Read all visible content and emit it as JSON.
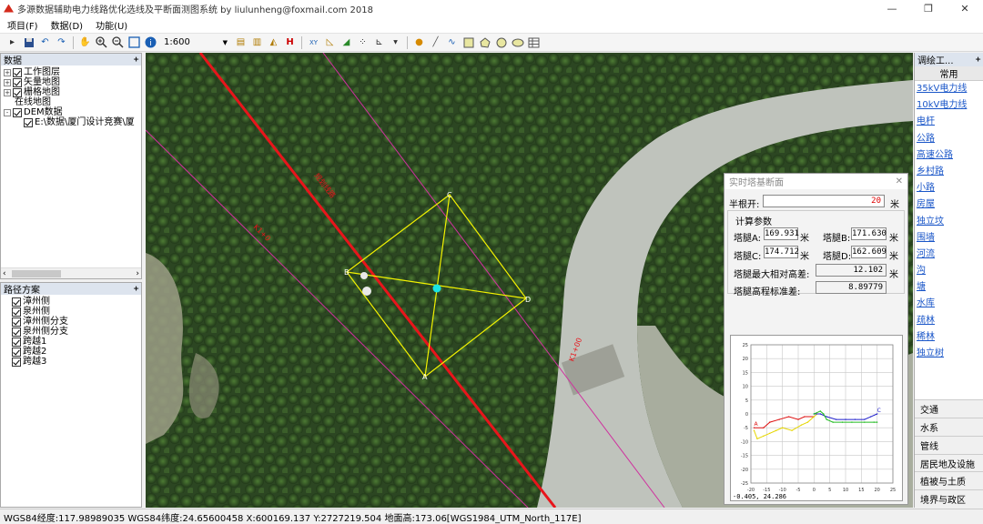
{
  "window": {
    "title": "多源数据辅助电力线路优化选线及平断面测图系统 by liulunheng@foxmail.com 2018",
    "minimize": "—",
    "restore": "❐",
    "close": "✕"
  },
  "menu": [
    "项目(F)",
    "数据(D)",
    "功能(U)"
  ],
  "toolbar": {
    "scale": "1:600",
    "icons": [
      "pointer-icon",
      "save-icon",
      "undo-icon",
      "redo-icon",
      "pan-hand-icon",
      "zoom-in-icon",
      "zoom-out-icon",
      "full-extent-icon",
      "info-icon",
      "scale-select",
      "tool-a-icon",
      "tool-b-icon",
      "tool-c-icon",
      "tool-h-icon",
      "xy-icon",
      "measure-icon",
      "profile-icon",
      "points-icon",
      "chart-icon",
      "point-draw-icon",
      "line-draw-icon",
      "curve-icon",
      "rect-icon",
      "polygon-icon",
      "circle-icon",
      "ellipse-icon",
      "table-icon"
    ]
  },
  "data_panel": {
    "title": "数据",
    "pin": "ᚐ",
    "items": [
      {
        "label": "工作图层",
        "level": 0,
        "expand": "+",
        "checked": true
      },
      {
        "label": "矢量地图",
        "level": 0,
        "expand": "+",
        "checked": true
      },
      {
        "label": "栅格地图",
        "level": 0,
        "expand": "+",
        "checked": true
      },
      {
        "label": "在线地图",
        "level": 0,
        "expand": "",
        "checked": false
      },
      {
        "label": "DEM数据",
        "level": 0,
        "expand": "-",
        "checked": true
      },
      {
        "label": "E:\\数据\\厦门设计竞赛\\厦",
        "level": 1,
        "expand": "",
        "checked": true
      }
    ]
  },
  "route_panel": {
    "title": "路径方案",
    "pin": "ᚐ",
    "items": [
      "漳州侧",
      "泉州侧",
      "漳州侧分支",
      "泉州侧分支",
      "跨越1",
      "跨越2",
      "跨越3"
    ]
  },
  "map": {
    "line_label_1": "规划线路",
    "line_label_2": "K1+0",
    "line_label_3": "K1+00",
    "tower_labels": {
      "A": "A",
      "B": "B",
      "C": "C",
      "D": "D"
    },
    "colors": {
      "route": "#e8151b",
      "corridor": "#d0309e",
      "tower": "#f2f200",
      "center": "#19e4e4"
    }
  },
  "dialog": {
    "title": "实时塔基断面",
    "close": "✕",
    "radius_label": "半根开:",
    "radius_value": "20",
    "unit": "米",
    "section_title": "计算参数",
    "legA_label": "塔腿A:",
    "legA_value": "169.931",
    "legB_label": "塔腿B:",
    "legB_value": "171.630",
    "legC_label": "塔腿C:",
    "legC_value": "174.712",
    "legD_label": "塔腿D:",
    "legD_value": "162.609",
    "maxdiff_label": "塔腿最大相对高差:",
    "maxdiff_value": "12.102",
    "std_label": "塔腿高程标准差:",
    "std_value": "8.89779",
    "readout": "-0.405, 24.286"
  },
  "chart_data": {
    "type": "line",
    "xlim": [
      -20,
      25
    ],
    "ylim": [
      -25,
      25
    ],
    "xticks": [
      "-20",
      "-15",
      "-10",
      "-5",
      "0",
      "5",
      "10",
      "15",
      "20",
      "25"
    ],
    "yticks": [
      "25",
      "20",
      "15",
      "10",
      "5",
      "0",
      "-5",
      "-10",
      "-15",
      "-20",
      "-25"
    ],
    "grid": true,
    "labels": {
      "A": "A",
      "C": "C"
    },
    "series": [
      {
        "color": "#dd1111",
        "points": [
          [
            -19,
            -5
          ],
          [
            -16,
            -5
          ],
          [
            -14,
            -3
          ],
          [
            -11,
            -2
          ],
          [
            -8,
            -1
          ],
          [
            -5,
            -2
          ],
          [
            -3,
            -1
          ],
          [
            0,
            -1
          ]
        ]
      },
      {
        "color": "#e6d600",
        "points": [
          [
            -19,
            -6
          ],
          [
            -18,
            -9
          ],
          [
            -16,
            -8
          ],
          [
            -14,
            -7
          ],
          [
            -12,
            -6
          ],
          [
            -10,
            -5
          ],
          [
            -7,
            -6
          ],
          [
            -4,
            -4
          ],
          [
            -2,
            -3
          ],
          [
            0,
            -1
          ],
          [
            1,
            0
          ]
        ]
      },
      {
        "color": "#2222cc",
        "points": [
          [
            0,
            0
          ],
          [
            2,
            0
          ],
          [
            4,
            -1
          ],
          [
            7,
            -2
          ],
          [
            10,
            -2
          ],
          [
            13,
            -2
          ],
          [
            16,
            -2
          ],
          [
            18,
            -1
          ],
          [
            20,
            0
          ]
        ]
      },
      {
        "color": "#22bb22",
        "points": [
          [
            0,
            0
          ],
          [
            2,
            1
          ],
          [
            3,
            0
          ],
          [
            4,
            -2
          ],
          [
            6,
            -3
          ],
          [
            9,
            -3
          ],
          [
            12,
            -3
          ],
          [
            16,
            -3
          ],
          [
            19,
            -3
          ],
          [
            20,
            -3
          ]
        ]
      }
    ]
  },
  "right_panel": {
    "title": "调绘工...",
    "pin": "ᚐ",
    "tab": "常用",
    "links": [
      "35kV电力线",
      "10kV电力线",
      "电杆",
      "公路",
      "高速公路",
      "乡村路",
      "小路",
      "房屋",
      "独立坟",
      "围墙",
      "河流",
      "沟",
      "塘",
      "水库",
      "疏林",
      "稀林",
      "独立树"
    ],
    "categories": [
      "交通",
      "水系",
      "管线",
      "居民地及设施",
      "植被与土质",
      "境界与政区"
    ]
  },
  "status": "WGS84经度:117.98989035 WGS84纬度:24.65600458 X:600169.137 Y:2727219.504 地面高:173.06[WGS1984_UTM_North_117E]"
}
